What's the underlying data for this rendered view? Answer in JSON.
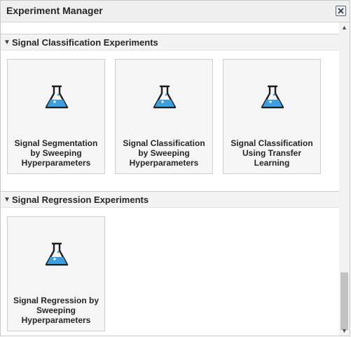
{
  "window": {
    "title": "Experiment Manager"
  },
  "sections": [
    {
      "title": "Signal Classification Experiments",
      "cards": [
        {
          "label": "Signal Segmentation by Sweeping Hyperparameters"
        },
        {
          "label": "Signal Classification by Sweeping Hyperparameters"
        },
        {
          "label": "Signal Classification Using Transfer Learning"
        }
      ]
    },
    {
      "title": "Signal Regression Experiments",
      "cards": [
        {
          "label": "Signal Regression by Sweeping Hyperparameters"
        }
      ]
    }
  ],
  "colors": {
    "flask_liquid": "#3b9fe0",
    "flask_outline": "#1f1f1f"
  },
  "icons": {
    "close": "close-icon",
    "collapse": "chevron-down-icon",
    "experiment": "flask-icon"
  }
}
